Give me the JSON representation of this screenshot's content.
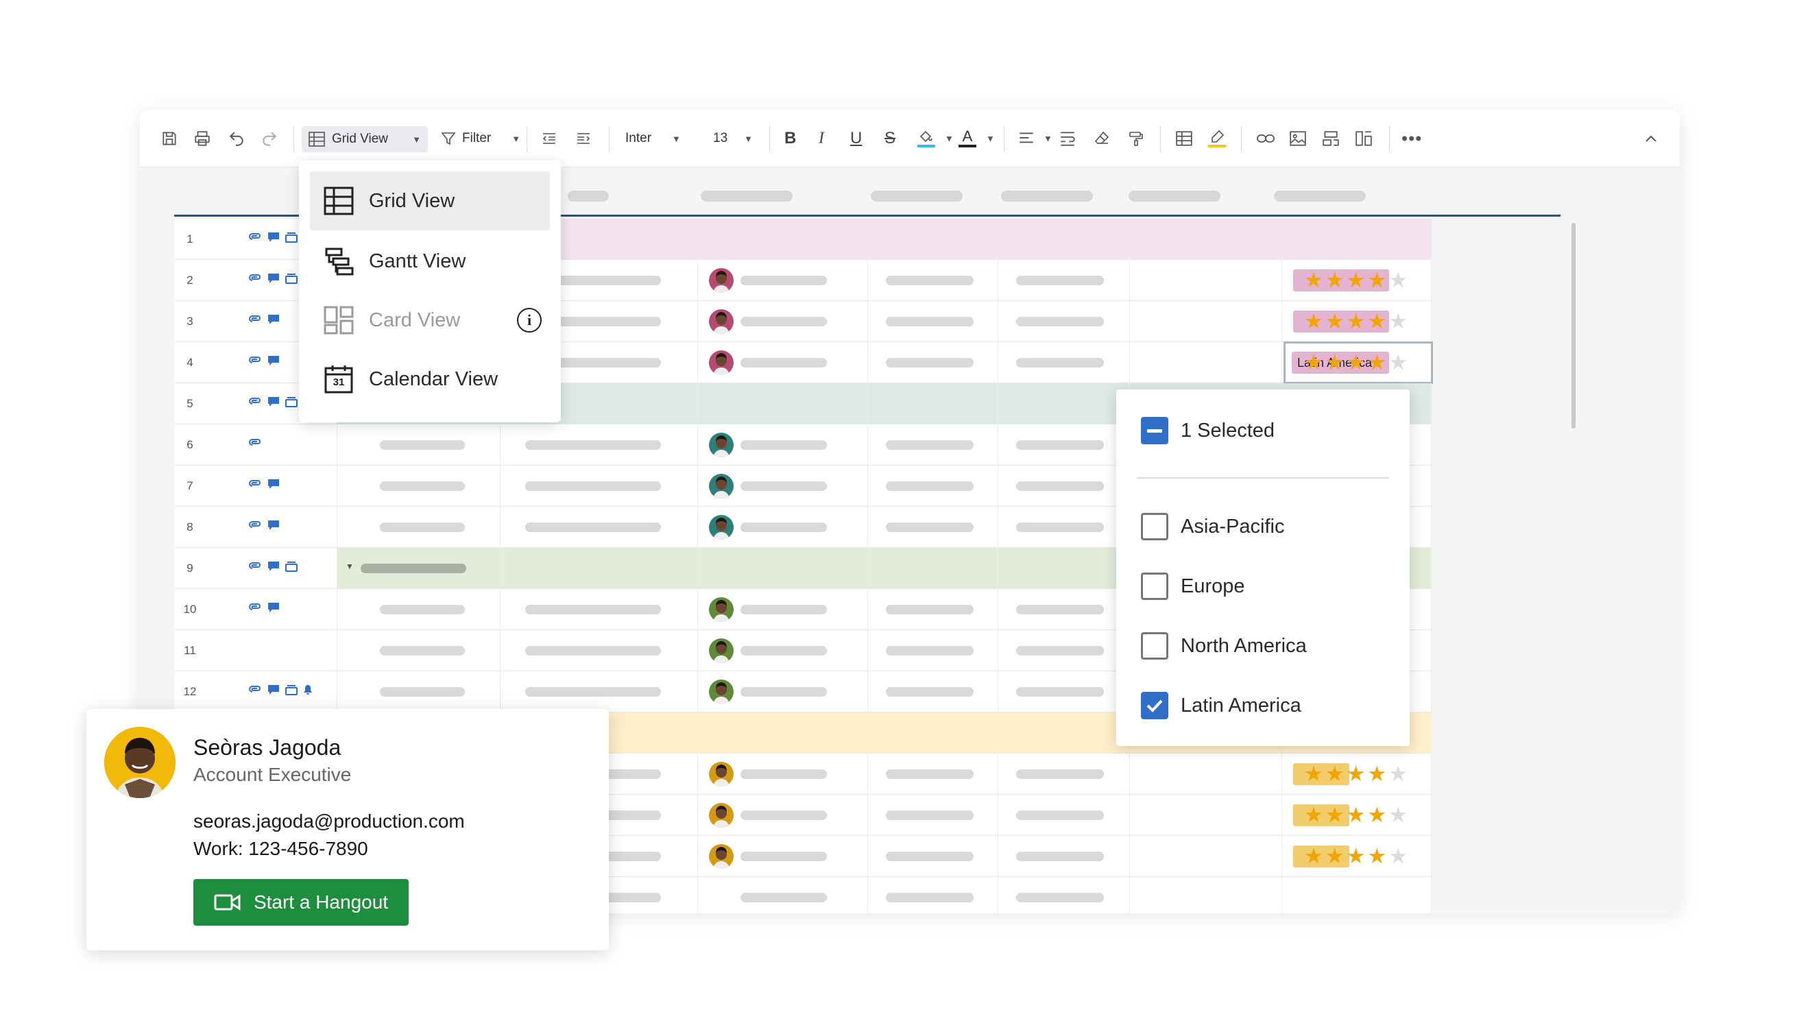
{
  "toolbar": {
    "view_label": "Grid View",
    "filter_label": "Filter",
    "font_family": "Inter",
    "font_size": "13"
  },
  "view_menu": {
    "items": [
      {
        "label": "Grid View",
        "icon": "grid-view-icon",
        "state": "active"
      },
      {
        "label": "Gantt View",
        "icon": "gantt-view-icon",
        "state": "normal"
      },
      {
        "label": "Card View",
        "icon": "card-view-icon",
        "state": "disabled"
      },
      {
        "label": "Calendar View",
        "icon": "calendar-view-icon",
        "state": "normal",
        "calendar_day": "31"
      }
    ]
  },
  "grid": {
    "row_numbers": [
      "1",
      "2",
      "3",
      "4",
      "5",
      "6",
      "7",
      "8",
      "9",
      "10",
      "11",
      "12"
    ],
    "selected_cell_value": "Latin America",
    "rating_max": 5,
    "ratings": [
      4,
      4,
      4,
      4,
      4,
      4
    ]
  },
  "region_filter": {
    "summary": "1 Selected",
    "options": [
      {
        "label": "Asia-Pacific",
        "checked": false
      },
      {
        "label": "Europe",
        "checked": false
      },
      {
        "label": "North America",
        "checked": false
      },
      {
        "label": "Latin America",
        "checked": true
      }
    ]
  },
  "contact_card": {
    "name": "Seòras Jagoda",
    "title": "Account Executive",
    "email": "seoras.jagoda@production.com",
    "phone": "Work: 123-456-7890",
    "action_label": "Start a Hangout"
  },
  "colors": {
    "accent_blue": "#2f6fc9",
    "header_rule": "#2f4f86",
    "pink_band": "#f3e3ef",
    "teal_band": "#dde9e7",
    "green_band": "#e3ecd9",
    "yellow_band": "#fdefc8",
    "pink_tag": "#e4b3d1",
    "yellow_tag": "#f3cd6c",
    "star": "#f0a500",
    "hangout_green": "#1e8e3e"
  }
}
